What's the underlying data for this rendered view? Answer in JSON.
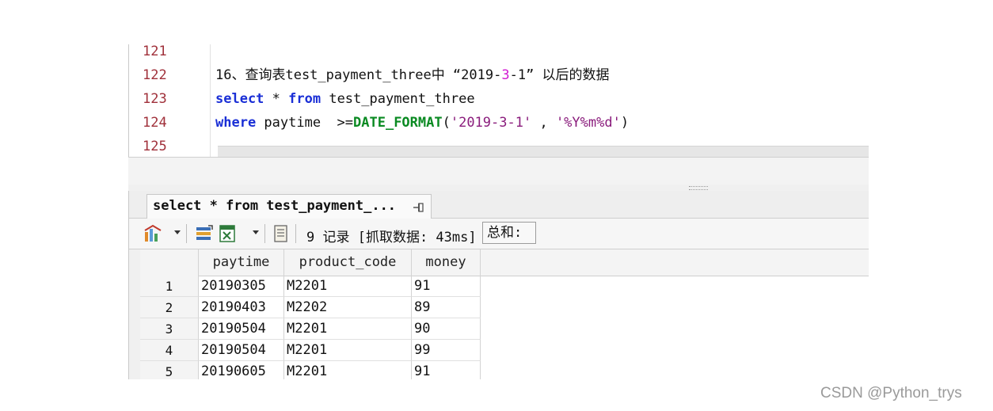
{
  "editor": {
    "line_numbers": [
      "121",
      "122",
      "123",
      "124",
      "125"
    ],
    "comment_line": {
      "prefix": "16、查询表test_payment_three中 “2019-",
      "highlight": "3",
      "suffix": "-1” 以后的数据"
    },
    "select_line": {
      "kw_select": "select",
      "star": " * ",
      "kw_from": "from",
      "table": " test_payment_three"
    },
    "where_line": {
      "kw_where": "where",
      "cond": " paytime  >=",
      "fn": "DATE_FORMAT",
      "open": "(",
      "arg1": "'2019-3-1'",
      "comma": " , ",
      "arg2": "'%Y%m%d'",
      "close": ")"
    }
  },
  "result": {
    "tab_label": "select * from test_payment_...",
    "record_info": "9 记录 [抓取数据: 43ms]",
    "sum_label": "总和:",
    "columns": [
      "paytime",
      "product_code",
      "money"
    ],
    "rows": [
      {
        "num": "1",
        "paytime": "20190305",
        "product_code": "M2201",
        "money": "91"
      },
      {
        "num": "2",
        "paytime": "20190403",
        "product_code": "M2202",
        "money": "89"
      },
      {
        "num": "3",
        "paytime": "20190504",
        "product_code": "M2201",
        "money": "90"
      },
      {
        "num": "4",
        "paytime": "20190504",
        "product_code": "M2201",
        "money": "99"
      },
      {
        "num": "5",
        "paytime": "20190605",
        "product_code": "M2201",
        "money": "91"
      }
    ]
  },
  "watermark": "CSDN @Python_trys",
  "icons": [
    "filter-icon",
    "column-icon",
    "export-excel-icon",
    "script-icon",
    "pin-icon"
  ],
  "colors": {
    "keyword": "#1a2fd6",
    "function": "#0a8a22",
    "string": "#8a1c7c",
    "line_number": "#a0303a"
  }
}
